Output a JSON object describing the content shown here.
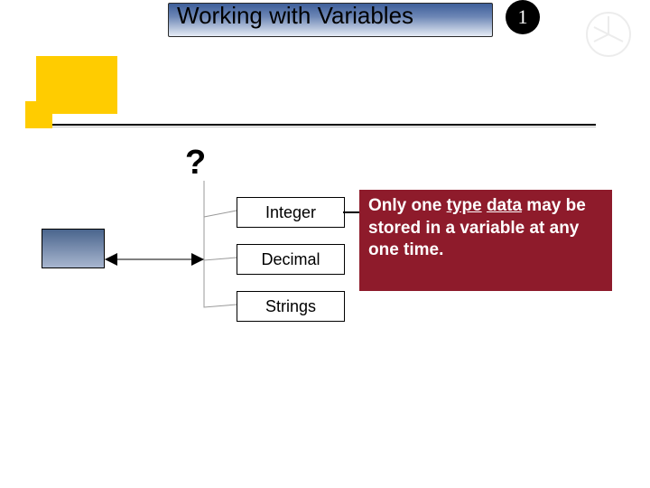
{
  "title": "Working with Variables",
  "slide_number": "1",
  "question_mark": "?",
  "types": {
    "integer": "Integer",
    "decimal": "Decimal",
    "strings": "Strings"
  },
  "callout": {
    "prefix": "Only one ",
    "u1": "type",
    "mid": " ",
    "u2": "data",
    "rest": " may be stored in a variable at any one time."
  }
}
